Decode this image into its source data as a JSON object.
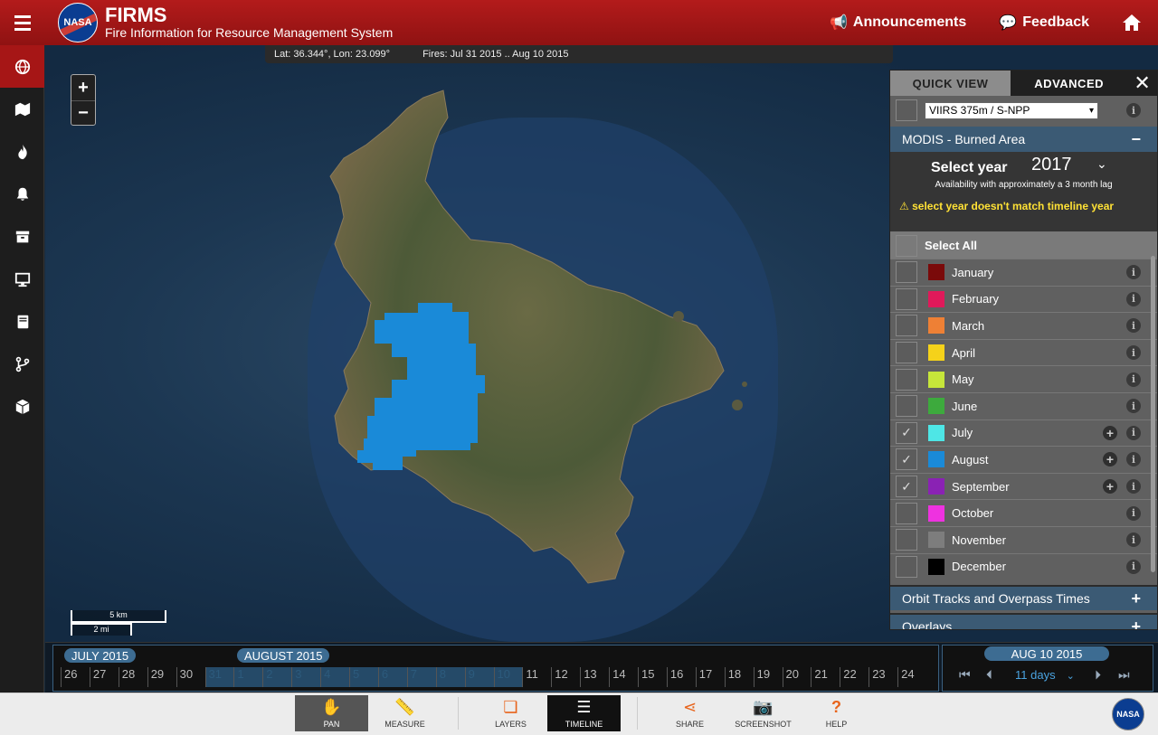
{
  "header": {
    "title": "FIRMS",
    "subtitle": "Fire Information for Resource Management System",
    "logo_text": "NASA",
    "announcements": "Announcements",
    "feedback": "Feedback"
  },
  "sidebar": {
    "items": [
      {
        "name": "globe-icon",
        "active": true
      },
      {
        "name": "map-icon"
      },
      {
        "name": "fire-icon"
      },
      {
        "name": "bell-icon"
      },
      {
        "name": "archive-icon"
      },
      {
        "name": "monitor-icon"
      },
      {
        "name": "book-icon"
      },
      {
        "name": "branch-icon"
      },
      {
        "name": "cube-icon"
      }
    ]
  },
  "map": {
    "coords": "Lat: 36.344°, Lon: 23.099°",
    "fires": "Fires: Jul 31 2015 .. Aug 10 2015",
    "zoom_in": "+",
    "zoom_out": "−",
    "scale_km": "5 km",
    "scale_mi": "2 mi"
  },
  "panel": {
    "tab_quick": "QUICK VIEW",
    "tab_advanced": "ADVANCED",
    "close": "✕",
    "satellite_select": "VIIRS 375m / S-NPP",
    "section_title": "MODIS - Burned Area",
    "section_toggle": "−",
    "select_year_label": "Select year",
    "year": "2017",
    "availability": "Availability with approximately a 3 month lag",
    "warning": "select year doesn't match timeline year",
    "select_all": "Select All",
    "months": [
      {
        "label": "January",
        "color": "#7a0a0a",
        "checked": false
      },
      {
        "label": "February",
        "color": "#e0195a",
        "checked": false
      },
      {
        "label": "March",
        "color": "#ee8035",
        "checked": false
      },
      {
        "label": "April",
        "color": "#f5d21a",
        "checked": false
      },
      {
        "label": "May",
        "color": "#c6e63a",
        "checked": false
      },
      {
        "label": "June",
        "color": "#3daa3d",
        "checked": false
      },
      {
        "label": "July",
        "color": "#4ee6e6",
        "checked": true
      },
      {
        "label": "August",
        "color": "#1a8ad8",
        "checked": true
      },
      {
        "label": "September",
        "color": "#8a22b4",
        "checked": true
      },
      {
        "label": "October",
        "color": "#ee32e0",
        "checked": false
      },
      {
        "label": "November",
        "color": "#7d7d7d",
        "checked": false
      },
      {
        "label": "December",
        "color": "#000000",
        "checked": false
      }
    ],
    "orbit_section": "Orbit Tracks and Overpass Times",
    "overlays_section": "Overlays"
  },
  "timeline": {
    "month1": "JULY 2015",
    "month2": "AUGUST 2015",
    "days": [
      "26",
      "27",
      "28",
      "29",
      "30",
      "31",
      "1",
      "2",
      "3",
      "4",
      "5",
      "6",
      "7",
      "8",
      "9",
      "10",
      "11",
      "12",
      "13",
      "14",
      "15",
      "16",
      "17",
      "18",
      "19",
      "20",
      "21",
      "22",
      "23",
      "24"
    ],
    "selected_date": "AUG 10 2015",
    "range": "11 days"
  },
  "toolbar": {
    "pan": "PAN",
    "measure": "MEASURE",
    "layers": "LAYERS",
    "timeline": "TIMELINE",
    "share": "SHARE",
    "screenshot": "SCREENSHOT",
    "help": "HELP",
    "nasa": "NASA"
  }
}
